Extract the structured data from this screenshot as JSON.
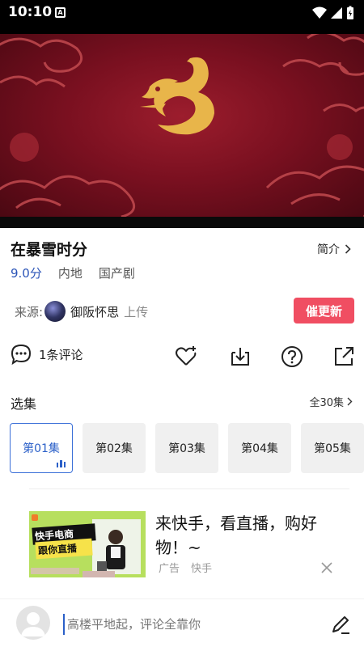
{
  "status_bar": {
    "time": "10:10",
    "notification_icon": "A"
  },
  "video": {
    "logo": "gold-dragon-emblem"
  },
  "show": {
    "title": "在暴雪时分",
    "intro_label": "简介",
    "score": "9.0分",
    "region": "内地",
    "genre": "国产剧"
  },
  "source": {
    "label": "来源:",
    "uploader": "御阪怀思",
    "upload_text": "上传",
    "urge_button": "催更新"
  },
  "actions": {
    "comment_count": "1条评论",
    "icons": [
      "heart-plus-icon",
      "download-icon",
      "help-icon",
      "share-icon"
    ]
  },
  "episodes": {
    "title": "选集",
    "all_label": "全30集",
    "items": [
      {
        "label": "第01集",
        "active": true
      },
      {
        "label": "第02集",
        "active": false
      },
      {
        "label": "第03集",
        "active": false
      },
      {
        "label": "第04集",
        "active": false
      },
      {
        "label": "第05集",
        "active": false
      }
    ]
  },
  "ad": {
    "text": "来快手，看直播，购好物！~",
    "tag": "广告",
    "source": "快手",
    "image_text_1": "快手电商",
    "image_text_2": "跟你直播"
  },
  "bottom": {
    "comment_placeholder": "高楼平地起，评论全靠你"
  },
  "colors": {
    "accent": "#2a5fc8",
    "urge": "#f04e62",
    "score": "#2c55b8"
  }
}
